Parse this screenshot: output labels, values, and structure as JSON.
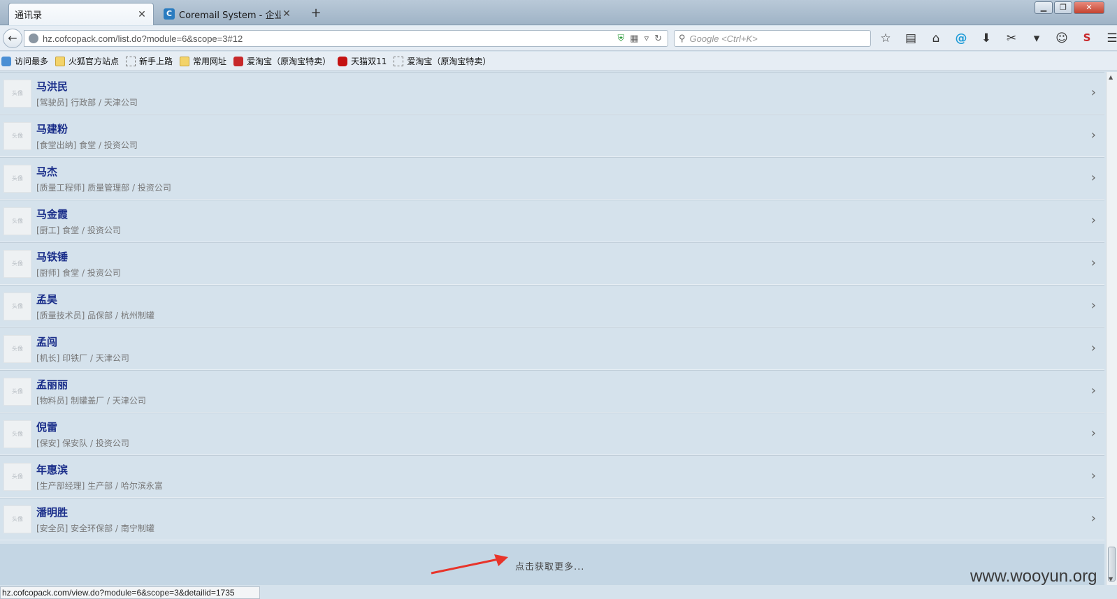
{
  "browser": {
    "tabs": [
      {
        "label": "通讯录",
        "active": true
      },
      {
        "label": "Coremail System - 企业...",
        "active": false,
        "favicon": "C"
      }
    ],
    "new_tab": "+",
    "url": "hz.cofcopack.com/list.do?module=6&scope=3#12",
    "search_placeholder": "Google <Ctrl+K>",
    "status_url": "hz.cofcopack.com/view.do?module=6&scope=3&detailid=1735"
  },
  "bookmarks": [
    {
      "label": "访问最多",
      "icon": "globe"
    },
    {
      "label": "火狐官方站点",
      "icon": "folder"
    },
    {
      "label": "新手上路",
      "icon": "dashed"
    },
    {
      "label": "常用网址",
      "icon": "folder"
    },
    {
      "label": "爱淘宝（原淘宝特卖）",
      "icon": "red"
    },
    {
      "label": "天猫双11",
      "icon": "black"
    },
    {
      "label": "爱淘宝（原淘宝特卖）",
      "icon": "dashed"
    }
  ],
  "contacts": [
    {
      "name": "马洪民",
      "detail": "[驾驶员] 行政部 / 天津公司"
    },
    {
      "name": "马建粉",
      "detail": "[食堂出纳] 食堂 / 投资公司"
    },
    {
      "name": "马杰",
      "detail": "[质量工程师] 质量管理部 / 投资公司"
    },
    {
      "name": "马金霞",
      "detail": "[厨工] 食堂 / 投资公司"
    },
    {
      "name": "马铁锤",
      "detail": "[厨师] 食堂 / 投资公司"
    },
    {
      "name": "孟昊",
      "detail": "[质量技术员] 品保部 / 杭州制罐"
    },
    {
      "name": "孟闯",
      "detail": "[机长] 印铁厂 / 天津公司"
    },
    {
      "name": "孟丽丽",
      "detail": "[物料员] 制罐盖厂 / 天津公司"
    },
    {
      "name": "倪雷",
      "detail": "[保安] 保安队 / 投资公司"
    },
    {
      "name": "年惠滨",
      "detail": "[生产部经理] 生产部 / 哈尔滨永富"
    },
    {
      "name": "潘明胜",
      "detail": "[安全员] 安全环保部 / 南宁制罐"
    }
  ],
  "load_more": "点击获取更多...",
  "watermark": "www.wooyun.org",
  "colors": {
    "name": "#1a2e8a",
    "background": "#d5e2ec",
    "arrow": "#e8342a"
  }
}
